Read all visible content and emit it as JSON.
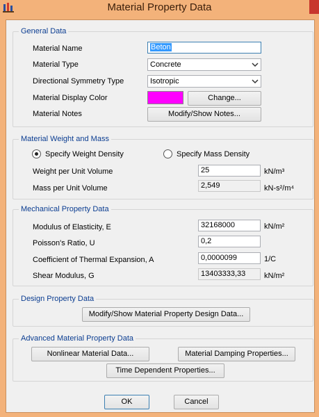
{
  "window": {
    "title": "Material Property Data",
    "app_icon": "etabs-app-icon",
    "close_icon": "close-icon",
    "titlebar_color": "#f3b27a",
    "close_color": "#c8372d"
  },
  "general_data": {
    "heading": "General Data",
    "material_name_label": "Material Name",
    "material_name_value": "Beton",
    "material_type_label": "Material Type",
    "material_type_value": "Concrete",
    "symmetry_label": "Directional Symmetry Type",
    "symmetry_value": "Isotropic",
    "display_color_label": "Material Display Color",
    "display_color": "#ff00ff",
    "change_button": "Change...",
    "notes_label": "Material Notes",
    "notes_button": "Modify/Show Notes..."
  },
  "weight_mass": {
    "heading": "Material Weight and Mass",
    "radio_weight": "Specify Weight Density",
    "radio_mass": "Specify Mass Density",
    "selected": "weight",
    "weight_label": "Weight per Unit Volume",
    "weight_value": "25",
    "weight_unit": "kN/m³",
    "mass_label": "Mass per Unit Volume",
    "mass_value": "2,549",
    "mass_unit": "kN-s²/m⁴"
  },
  "mechanical": {
    "heading": "Mechanical Property Data",
    "modulus_label": "Modulus of Elasticity,  E",
    "modulus_value": "32168000",
    "modulus_unit": "kN/m²",
    "poisson_label": "Poisson's Ratio,  U",
    "poisson_value": "0,2",
    "thermal_label": "Coefficient of Thermal Expansion,  A",
    "thermal_value": "0,0000099",
    "thermal_unit": "1/C",
    "shear_label": "Shear Modulus,  G",
    "shear_value": "13403333,33",
    "shear_unit": "kN/m²"
  },
  "design": {
    "heading": "Design Property Data",
    "button": "Modify/Show Material Property Design Data..."
  },
  "advanced": {
    "heading": "Advanced Material Property Data",
    "nonlinear_button": "Nonlinear Material Data...",
    "damping_button": "Material Damping Properties...",
    "time_button": "Time Dependent Properties..."
  },
  "footer": {
    "ok": "OK",
    "cancel": "Cancel"
  }
}
